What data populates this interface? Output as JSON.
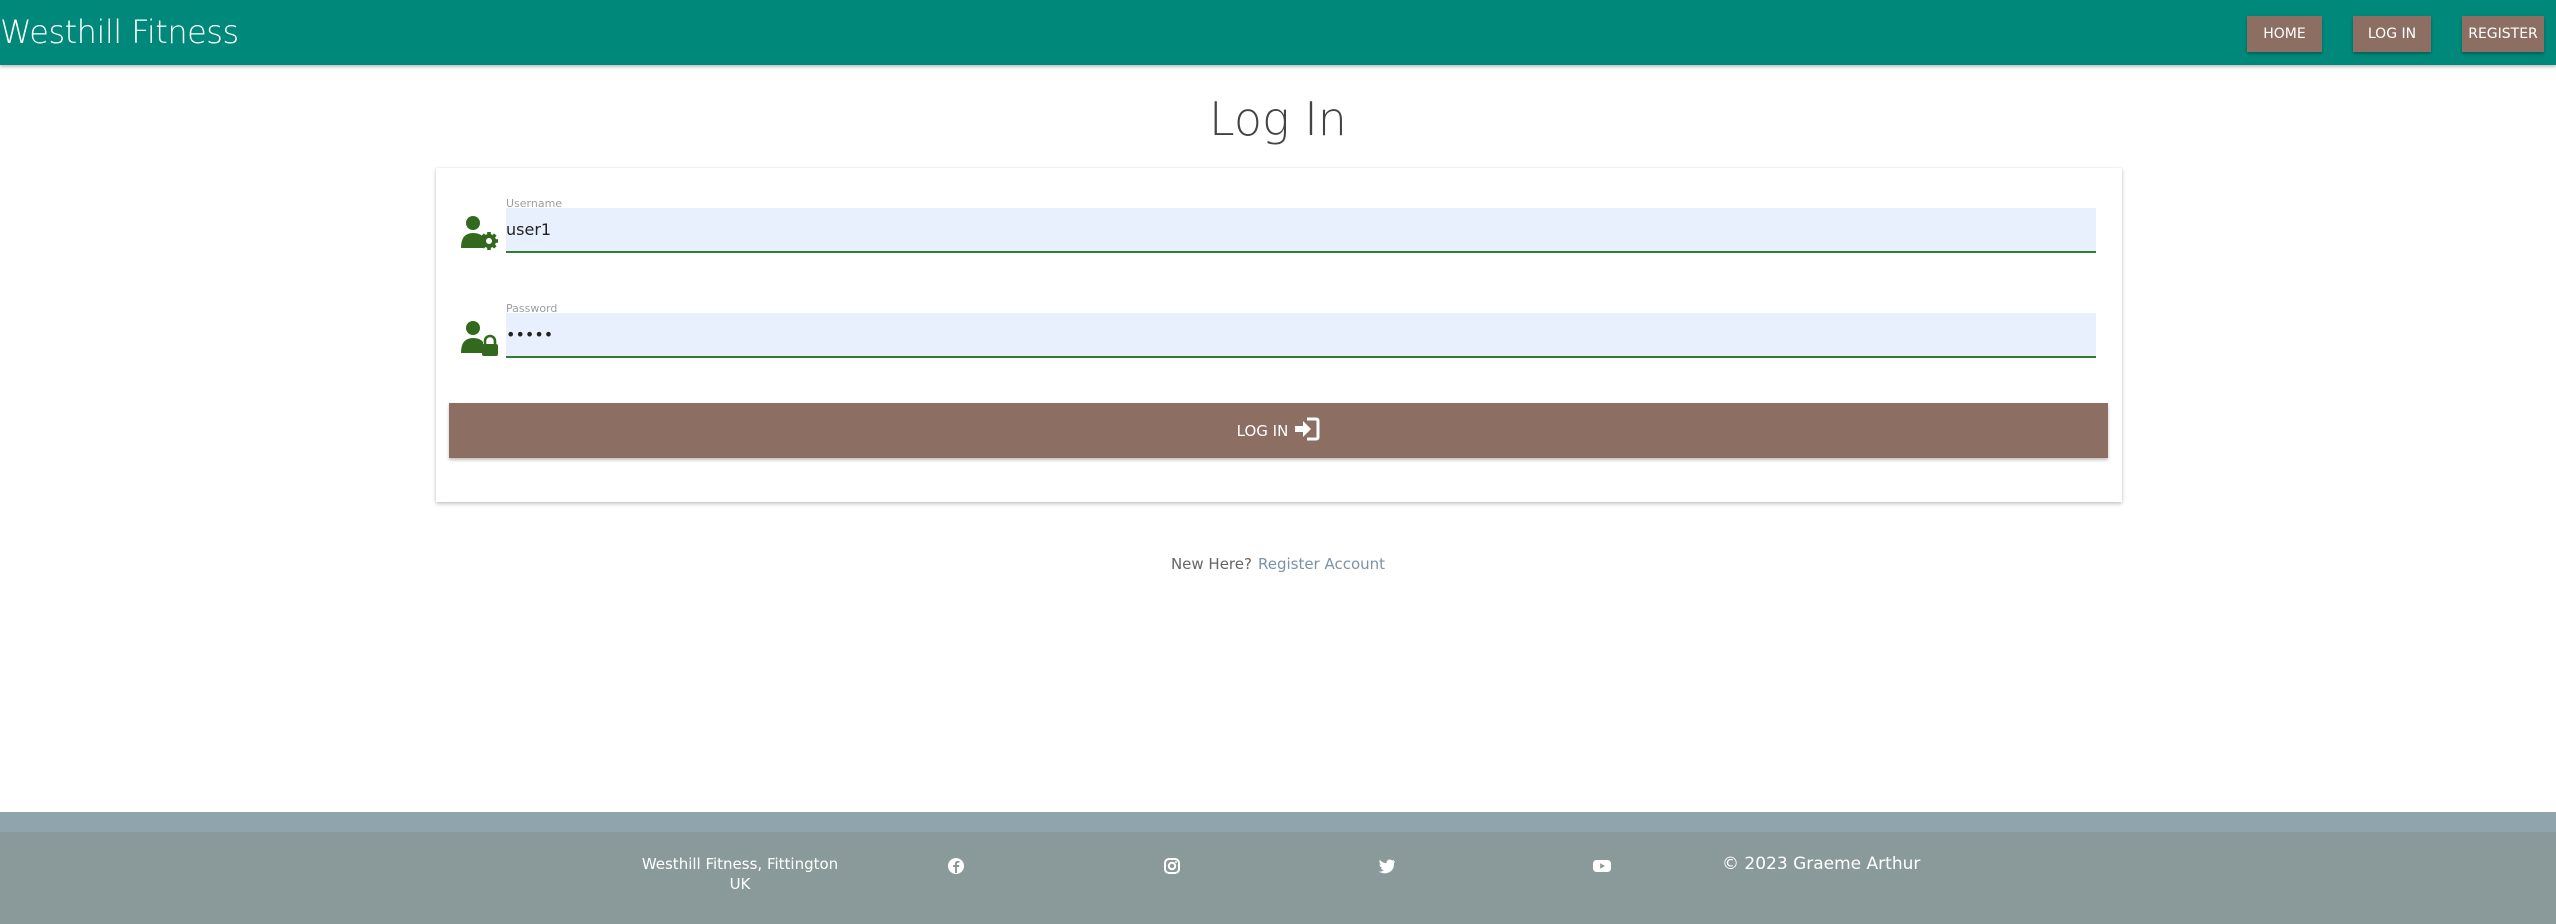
{
  "nav": {
    "brand": "Westhill Fitness",
    "items": [
      {
        "label": "HOME"
      },
      {
        "label": "LOG IN"
      },
      {
        "label": "REGISTER"
      }
    ]
  },
  "page": {
    "title": "Log In"
  },
  "form": {
    "username": {
      "label": "Username",
      "value": "user1",
      "icon": "user-gear-icon"
    },
    "password": {
      "label": "Password",
      "value": "•••••",
      "icon": "user-lock-icon"
    },
    "submit": {
      "label": "LOG IN",
      "icon": "sign-in-icon"
    }
  },
  "register_prompt": {
    "question": "New Here?",
    "link": "Register Account"
  },
  "footer": {
    "address_line1": "Westhill Fitness, Fittington",
    "address_line2": "UK",
    "social": [
      "facebook-icon",
      "instagram-icon",
      "twitter-icon",
      "youtube-icon"
    ],
    "copyright": "© 2023 Graeme Arthur"
  },
  "colors": {
    "navbar": "#00897b",
    "button": "#8d6e63",
    "footer": "#8a9a9b",
    "input_underline": "#2e7d32",
    "icon": "#33691e"
  }
}
